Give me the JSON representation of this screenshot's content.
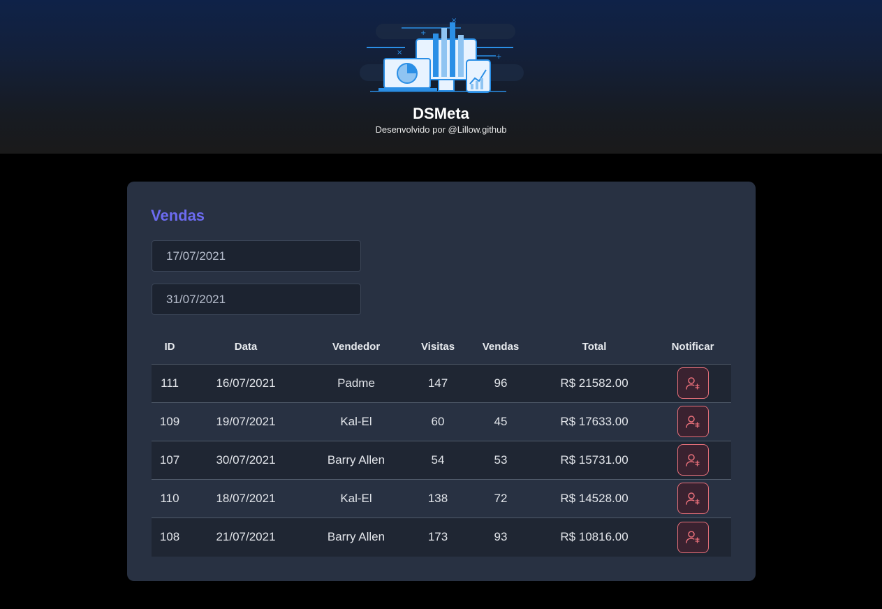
{
  "header": {
    "app_title": "DSMeta",
    "subtitle": "Desenvolvido por @Lillow.github",
    "logo_icon": "dashboard-devices-illustration"
  },
  "card": {
    "title": "Vendas",
    "min_date": "17/07/2021",
    "max_date": "31/07/2021"
  },
  "table": {
    "columns": [
      "ID",
      "Data",
      "Vendedor",
      "Visitas",
      "Vendas",
      "Total",
      "Notificar"
    ],
    "rows": [
      {
        "id": "111",
        "date": "16/07/2021",
        "seller": "Padme",
        "visits": "147",
        "sales": "96",
        "total": "R$ 21582.00"
      },
      {
        "id": "109",
        "date": "19/07/2021",
        "seller": "Kal-El",
        "visits": "60",
        "sales": "45",
        "total": "R$ 17633.00"
      },
      {
        "id": "107",
        "date": "30/07/2021",
        "seller": "Barry Allen",
        "visits": "54",
        "sales": "53",
        "total": "R$ 15731.00"
      },
      {
        "id": "110",
        "date": "18/07/2021",
        "seller": "Kal-El",
        "visits": "138",
        "sales": "72",
        "total": "R$ 14528.00"
      },
      {
        "id": "108",
        "date": "21/07/2021",
        "seller": "Barry Allen",
        "visits": "173",
        "sales": "93",
        "total": "R$ 10816.00"
      }
    ],
    "notify_icon": "user-notify-icon"
  },
  "colors": {
    "accent": "#6c6bf0",
    "notify": "#e8707a",
    "card_bg": "#283142",
    "page_bg": "#000000"
  }
}
